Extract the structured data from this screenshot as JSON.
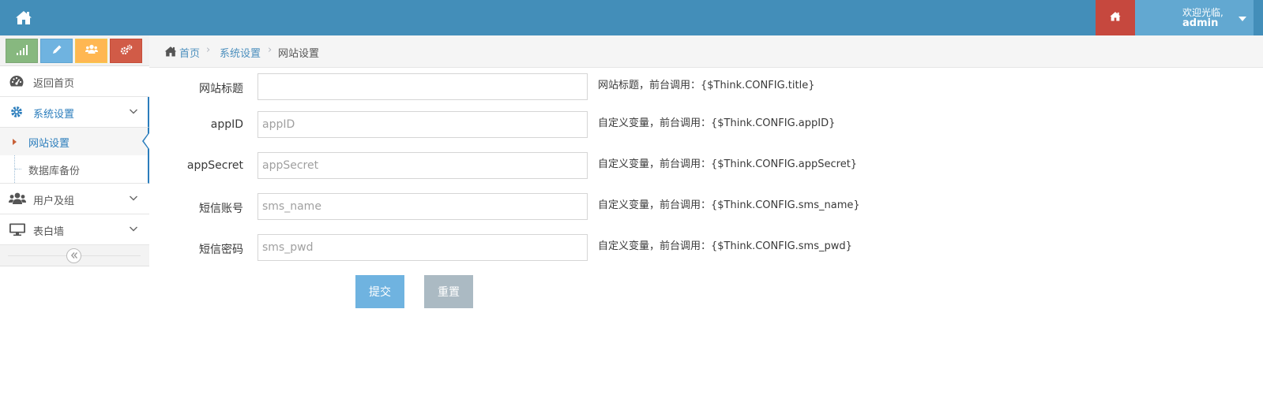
{
  "colors": {
    "navbar": "#438eb9",
    "navbar_home": "#c6483e",
    "user_box": "#62a8d1",
    "link": "#4c8fbd",
    "submit_button": "#6fb3e0",
    "reset_button": "#abbac3"
  },
  "navbar": {
    "home_icon": "home-icon",
    "right_home_icon": "home-icon",
    "user": {
      "welcome": "欢迎光临,",
      "name": "admin"
    }
  },
  "sidebar": {
    "shortcuts": [
      {
        "icon": "signal-icon",
        "color": "#87b87f"
      },
      {
        "icon": "pencil-icon",
        "color": "#6fb3e0"
      },
      {
        "icon": "users-icon",
        "color": "#ffb752"
      },
      {
        "icon": "cogs-icon",
        "color": "#d15b47"
      }
    ],
    "menu": [
      {
        "label": "返回首页",
        "icon": "dashboard-icon"
      },
      {
        "label": "系统设置",
        "icon": "gear-icon",
        "expanded": true,
        "children": [
          {
            "label": "网站设置",
            "active": true
          },
          {
            "label": "数据库备份"
          }
        ]
      },
      {
        "label": "用户及组",
        "icon": "users-icon"
      },
      {
        "label": "表白墙",
        "icon": "desktop-icon"
      }
    ],
    "collapse_icon": "double-angle-left-icon"
  },
  "breadcrumb": {
    "home": "首页",
    "section": "系统设置",
    "current": "网站设置"
  },
  "form": {
    "fields": [
      {
        "label": "网站标题",
        "value": "",
        "placeholder": "",
        "help": "网站标题，前台调用：{$Think.CONFIG.title}"
      },
      {
        "label": "appID",
        "value": "",
        "placeholder": "appID",
        "help": "自定义变量，前台调用：{$Think.CONFIG.appID}"
      },
      {
        "label": "appSecret",
        "value": "",
        "placeholder": "appSecret",
        "help": "自定义变量，前台调用：{$Think.CONFIG.appSecret}"
      },
      {
        "label": "短信账号",
        "value": "",
        "placeholder": "sms_name",
        "help": "自定义变量，前台调用：{$Think.CONFIG.sms_name}"
      },
      {
        "label": "短信密码",
        "value": "",
        "placeholder": "sms_pwd",
        "help": "自定义变量，前台调用：{$Think.CONFIG.sms_pwd}"
      }
    ],
    "submit_label": "提交",
    "reset_label": "重置"
  }
}
